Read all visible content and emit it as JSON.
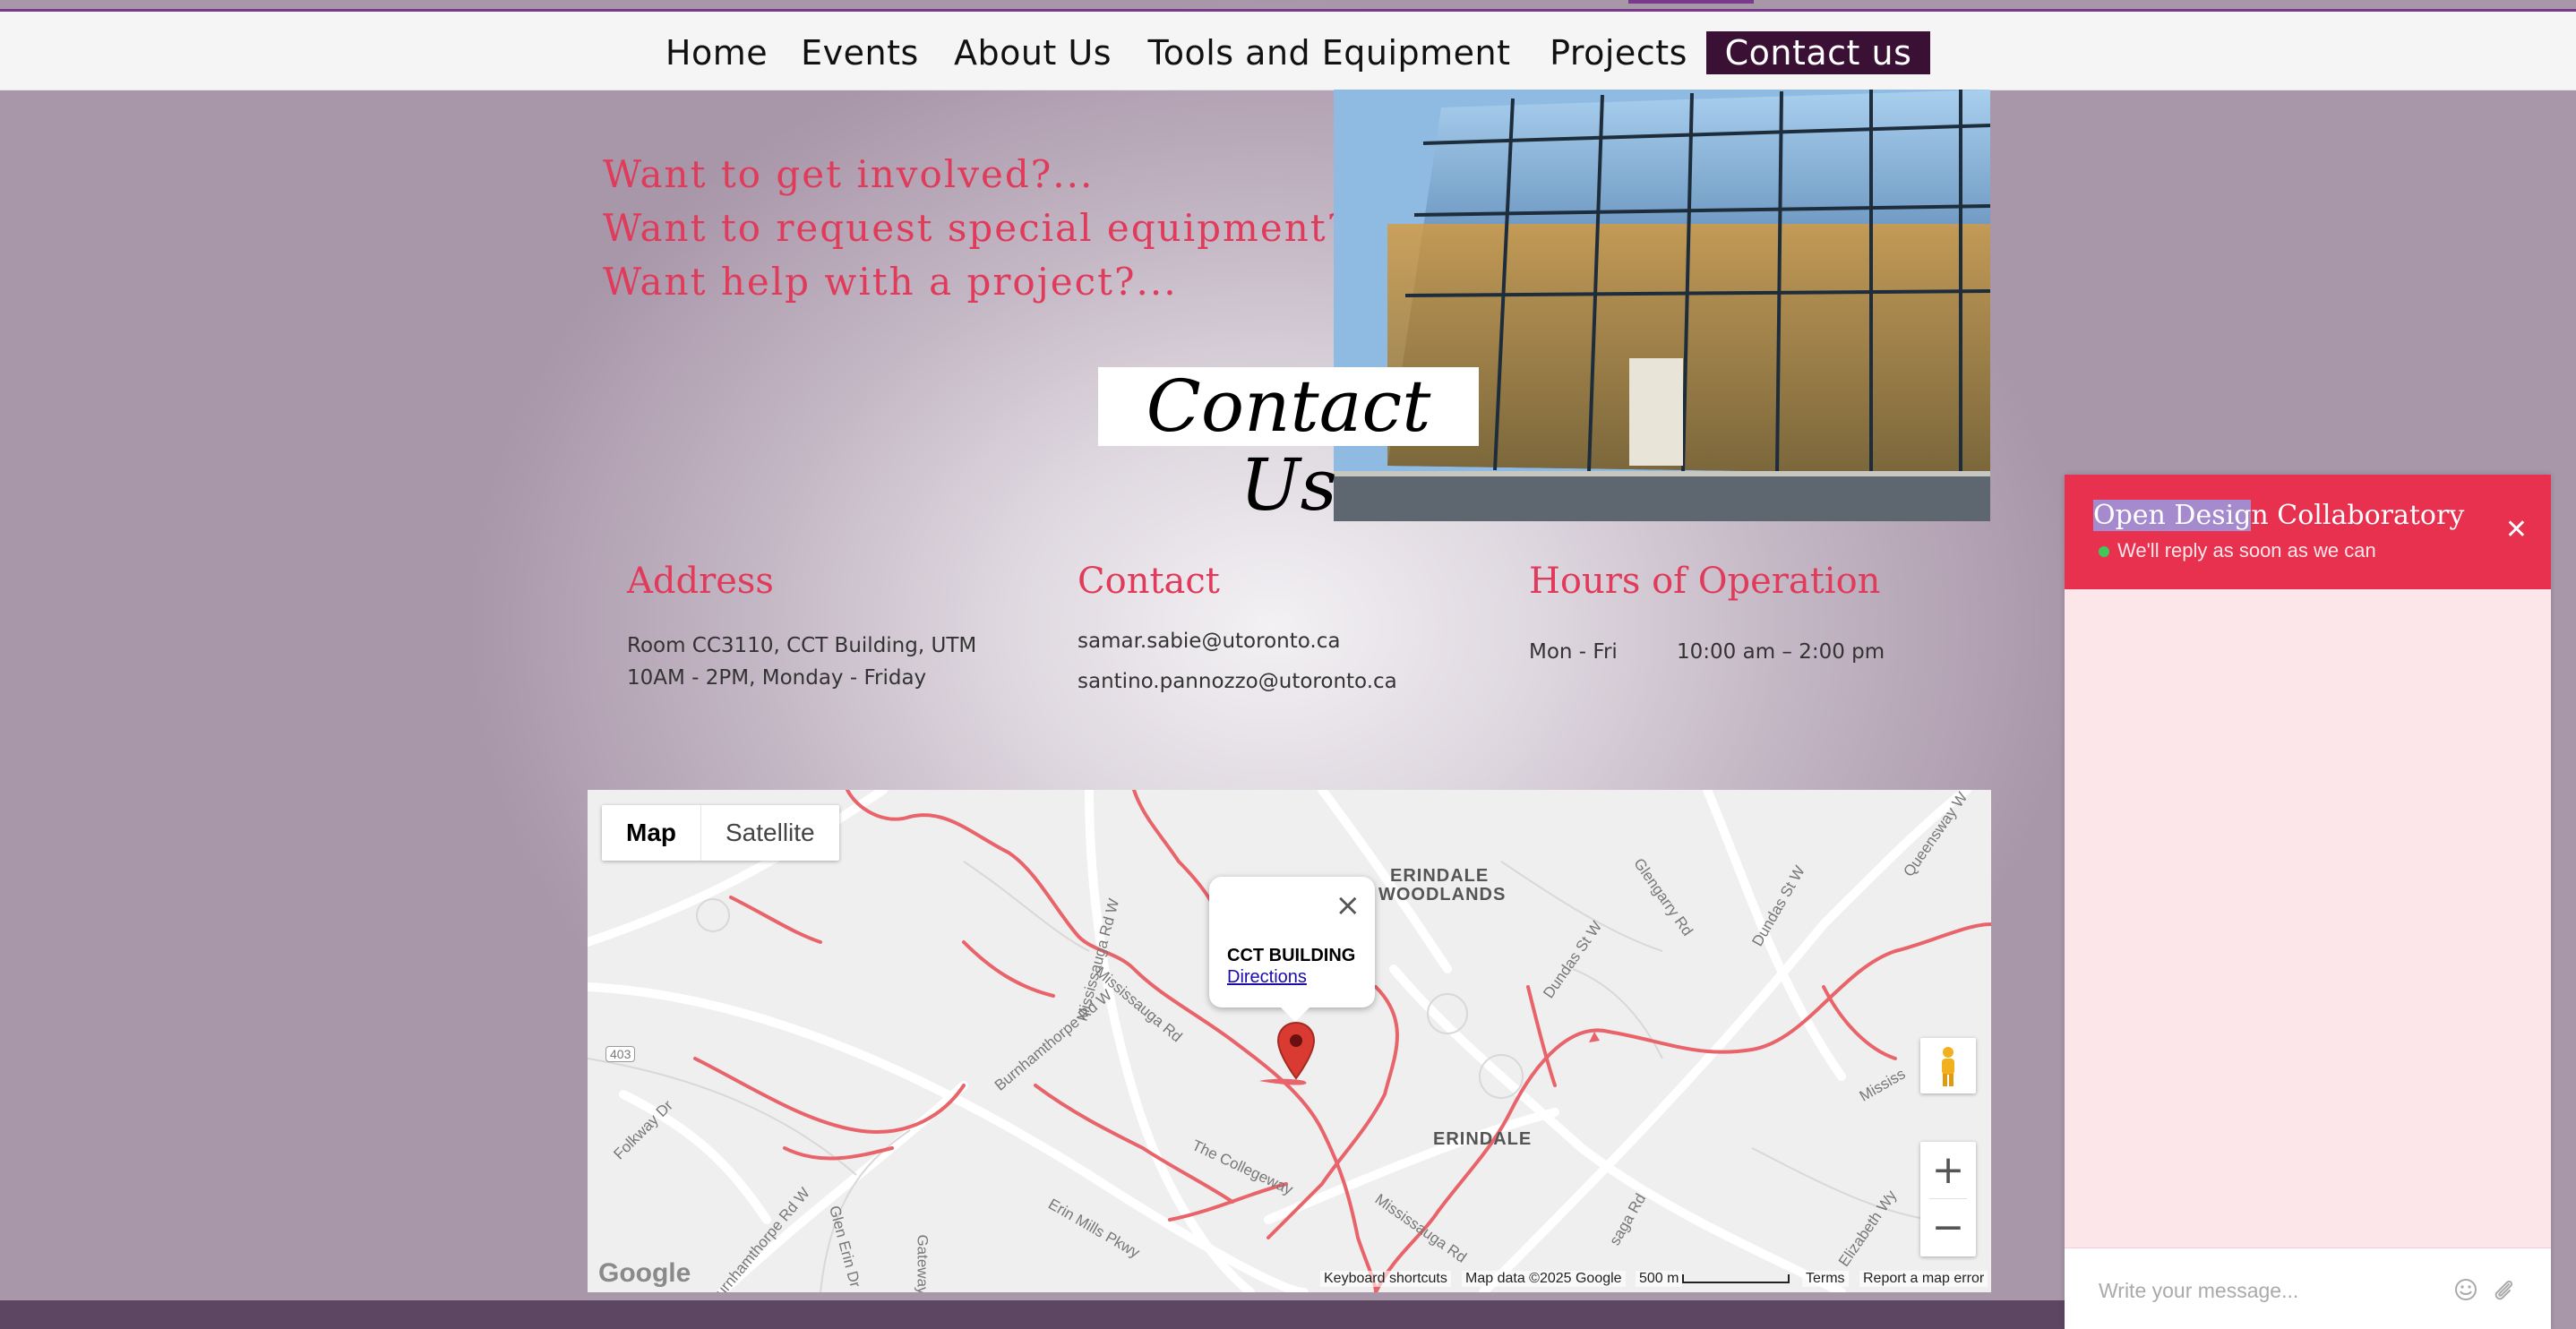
{
  "nav": {
    "items": [
      {
        "label": "Home"
      },
      {
        "label": "Events"
      },
      {
        "label": "About Us"
      },
      {
        "label": "Tools and Equipment"
      },
      {
        "label": "Projects"
      },
      {
        "label": "Contact us",
        "active": true
      }
    ]
  },
  "hero": {
    "lines": [
      "Want to get involved?...",
      "Want to request special equipment?..",
      "Want help with a project?..."
    ],
    "title": "Contact Us"
  },
  "info": {
    "address": {
      "heading": "Address",
      "lines": [
        "Room CC3110, CCT Building, UTM",
        "10AM - 2PM, Monday - Friday"
      ]
    },
    "contact": {
      "heading": "Contact",
      "lines": [
        "samar.sabie@utoronto.ca",
        "santino.pannozzo@utoronto.ca"
      ]
    },
    "hours": {
      "heading": "Hours of Operation",
      "days": "Mon - Fri",
      "time": "10:00 am – 2:00 pm"
    }
  },
  "map": {
    "type_map": "Map",
    "type_satellite": "Satellite",
    "popup_title": "CCT BUILDING",
    "popup_link": "Directions",
    "popup_close": "×",
    "labels": {
      "erindale_woodlands_1": "ERINDALE",
      "erindale_woodlands_2": "WOODLANDS",
      "erindale": "ERINDALE",
      "mississauga_rd": "Mississauga Rd",
      "mississauga_rd_w": "Mississauga Rd W",
      "burnhamthorpe": "Burnhamthorpe Rd W",
      "burnhamthorpe2": "Burnhamthorpe Rd W",
      "collegeway": "The Collegeway",
      "erin_mills": "Erin Mills Pkwy",
      "glen_erin": "Glen Erin Dr",
      "folkway": "Folkway Dr",
      "dundas1": "Dundas St W",
      "dundas2": "Dundas St W",
      "glengarry": "Glengarry Rd",
      "queensway": "Queensway W",
      "mississauga2": "Mississauga Rd",
      "mississauga3": "Mississ",
      "elizabeth": "Elizabeth Wy",
      "hwy": "403",
      "gateway": "Gateway",
      "saga": "saga Rd"
    },
    "zoom_in": "+",
    "zoom_out": "−",
    "footer": {
      "shortcuts": "Keyboard shortcuts",
      "data": "Map data ©2025 Google",
      "scale": "500 m",
      "terms": "Terms",
      "report": "Report a map error"
    },
    "google": "Google"
  },
  "chat": {
    "title_selected": "Open Desig",
    "title_rest": "n Collaboratory",
    "status": "We'll reply as soon as we can",
    "close": "✕",
    "placeholder": "Write your message..."
  },
  "colors": {
    "accent": "#e03b5a",
    "nav_active": "#3a1034",
    "chat_header": "#e8304f",
    "river": "#e8646a"
  }
}
